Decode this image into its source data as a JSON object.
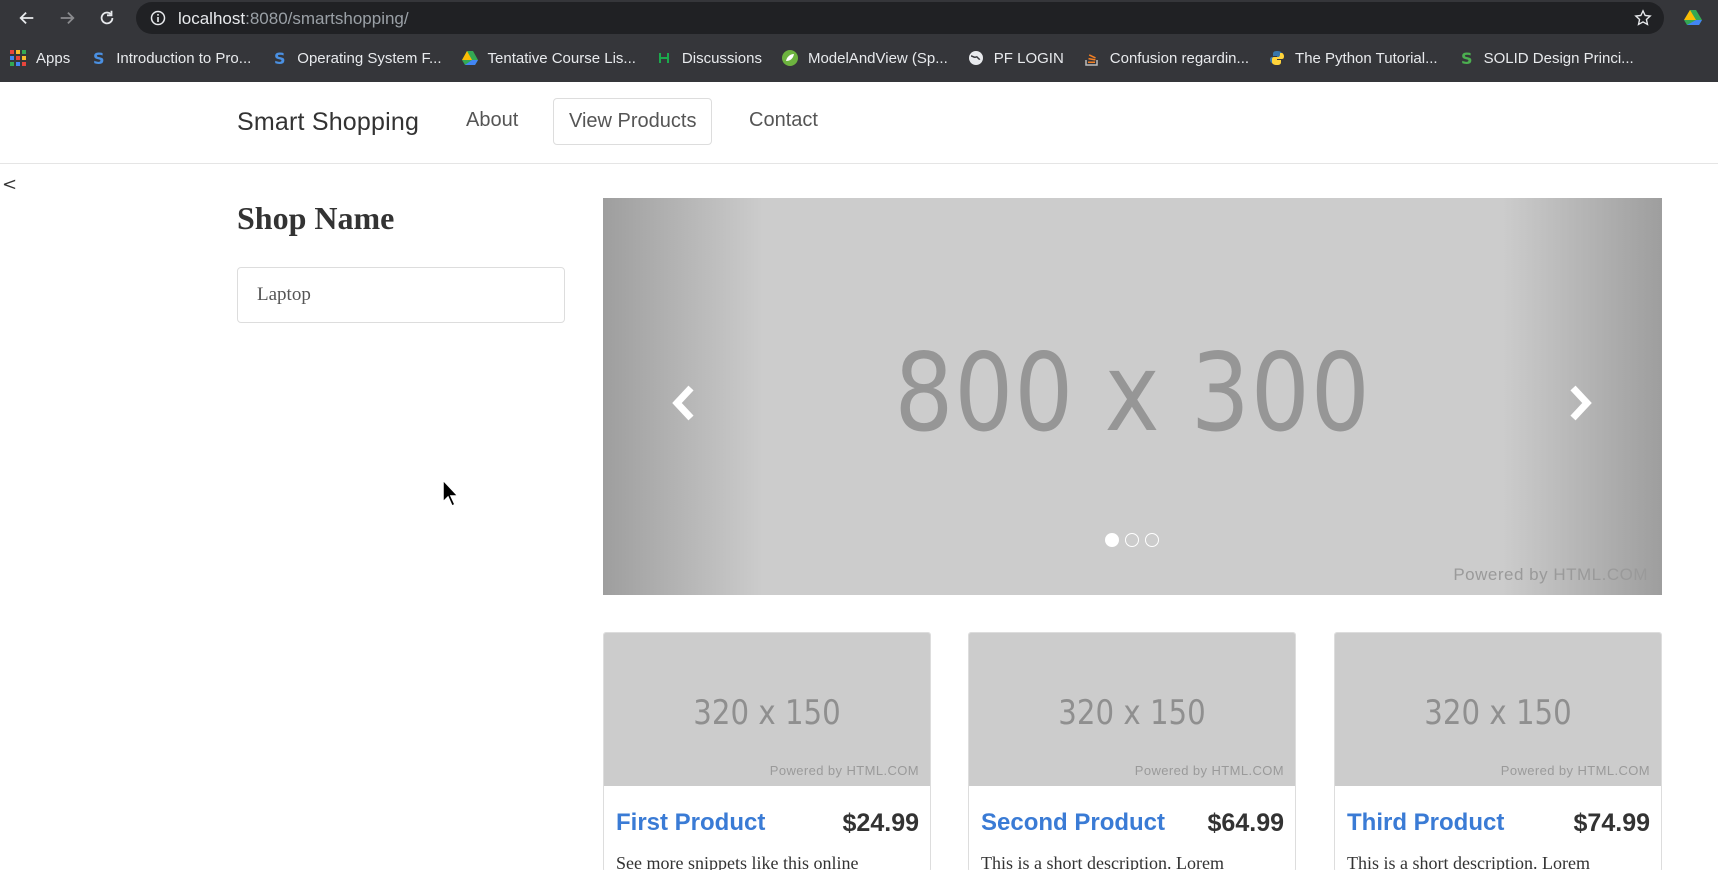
{
  "browser": {
    "url_host": "localhost",
    "url_rest": ":8080/smartshopping/",
    "bookmarks": [
      {
        "label": "Apps",
        "icon": "apps-grid-icon",
        "color": "#e8453c"
      },
      {
        "label": "Introduction to Pro...",
        "icon": "s-logo-icon",
        "color": "#4a90e2"
      },
      {
        "label": "Operating System F...",
        "icon": "s-logo-icon",
        "color": "#4a90e2"
      },
      {
        "label": "Tentative Course Lis...",
        "icon": "google-drive-icon",
        "color": "#34a853"
      },
      {
        "label": "Discussions",
        "icon": "hackerrank-icon",
        "color": "#ffffff"
      },
      {
        "label": "ModelAndView (Sp...",
        "icon": "spring-leaf-icon",
        "color": "#6db33f"
      },
      {
        "label": "PF LOGIN",
        "icon": "globe-icon",
        "color": "#e8eaed"
      },
      {
        "label": "Confusion regardin...",
        "icon": "stackoverflow-icon",
        "color": "#f48024"
      },
      {
        "label": "The Python Tutorial...",
        "icon": "python-icon",
        "color": "#ffd43b"
      },
      {
        "label": "SOLID Design Princi...",
        "icon": "solid-logo-icon",
        "color": "#4caf50"
      }
    ]
  },
  "nav": {
    "brand": "Smart Shopping",
    "links": [
      "About",
      "View Products",
      "Contact"
    ],
    "active_index": 1
  },
  "stray": "<",
  "sidebar": {
    "title": "Shop Name",
    "items": [
      "Laptop"
    ]
  },
  "carousel": {
    "placeholder": "800 x 300",
    "powered": "Powered by HTML.COM",
    "slide_count": 3,
    "active_slide": 1
  },
  "products": [
    {
      "title": "First Product",
      "price": "$24.99",
      "placeholder": "320 x 150",
      "powered": "Powered by HTML.COM",
      "description": "See more snippets like this online"
    },
    {
      "title": "Second Product",
      "price": "$64.99",
      "placeholder": "320 x 150",
      "powered": "Powered by HTML.COM",
      "description": "This is a short description. Lorem"
    },
    {
      "title": "Third Product",
      "price": "$74.99",
      "placeholder": "320 x 150",
      "powered": "Powered by HTML.COM",
      "description": "This is a short description. Lorem"
    }
  ],
  "colors": {
    "chrome": "#35363a",
    "omnibox": "#202124",
    "link": "#3a7bd5",
    "placeholder_bg": "#cccccc"
  }
}
